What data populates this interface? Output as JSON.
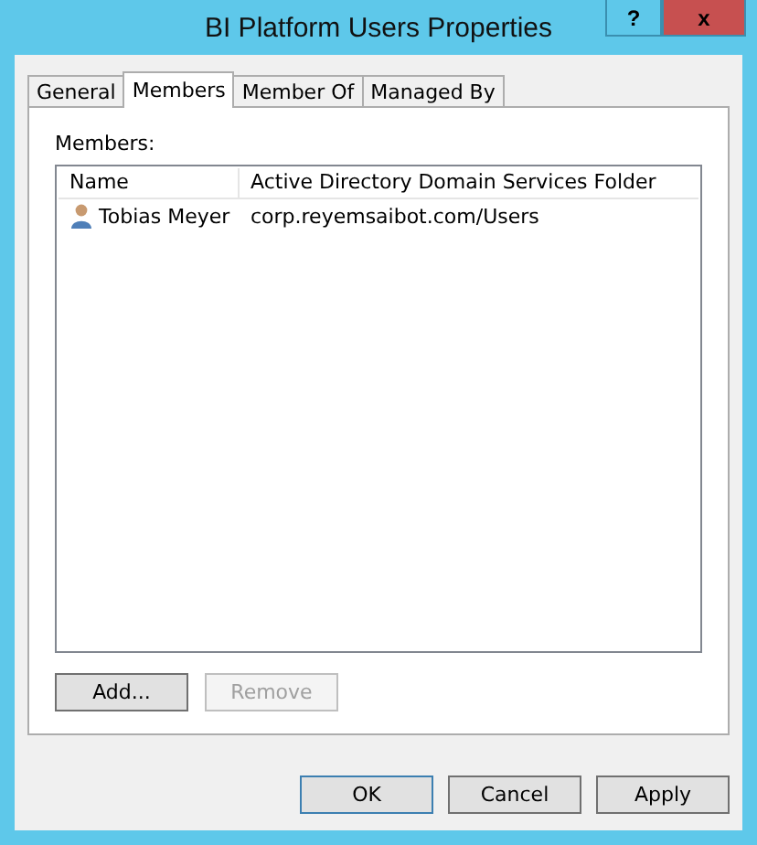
{
  "window": {
    "title": "BI Platform Users Properties",
    "help": "?",
    "close": "x"
  },
  "tabs": [
    {
      "label": "General",
      "selected": false
    },
    {
      "label": "Members",
      "selected": true
    },
    {
      "label": "Member Of",
      "selected": false
    },
    {
      "label": "Managed By",
      "selected": false
    }
  ],
  "members_label": "Members:",
  "table": {
    "columns": [
      "Name",
      "Active Directory Domain Services Folder"
    ],
    "rows": [
      {
        "name": "Tobias Meyer",
        "folder": "corp.reyemsaibot.com/Users"
      }
    ]
  },
  "list_buttons": [
    {
      "label": "Add...",
      "disabled": false
    },
    {
      "label": "Remove",
      "disabled": true
    }
  ],
  "buttons": [
    {
      "label": "OK",
      "default": true
    },
    {
      "label": "Cancel",
      "default": false
    },
    {
      "label": "Apply",
      "default": false
    }
  ]
}
